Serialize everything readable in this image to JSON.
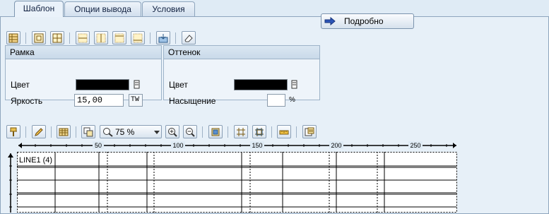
{
  "tabs": [
    {
      "label": "Шаблон",
      "active": true
    },
    {
      "label": "Опции вывода",
      "active": false
    },
    {
      "label": "Условия",
      "active": false
    }
  ],
  "toolbar1_icons": [
    "table-layout-icon",
    "cell-insert-icon",
    "cell-split-icon",
    "line-top-icon",
    "line-middle-icon",
    "line-bottom-icon",
    "line-full-icon",
    "transfer-icon",
    "eraser-icon"
  ],
  "details_button": {
    "label": "Подробно",
    "icon": "arrow-right-icon"
  },
  "frame_group": {
    "title": "Рамка",
    "color_label": "Цвет",
    "color_value": "#000000",
    "brightness_label": "Яркость",
    "brightness_value": "15,00",
    "unit_value": "TW"
  },
  "shade_group": {
    "title": "Оттенок",
    "color_label": "Цвет",
    "color_value": "#000000",
    "saturation_label": "Насыщение",
    "saturation_value": "",
    "saturation_unit": "%"
  },
  "toolbar2": {
    "zoom_value": "75 %"
  },
  "ruler": {
    "ticks": [
      "50",
      "100",
      "150",
      "200",
      "250"
    ]
  },
  "table": {
    "first_cell": "LINE1 (4)"
  }
}
